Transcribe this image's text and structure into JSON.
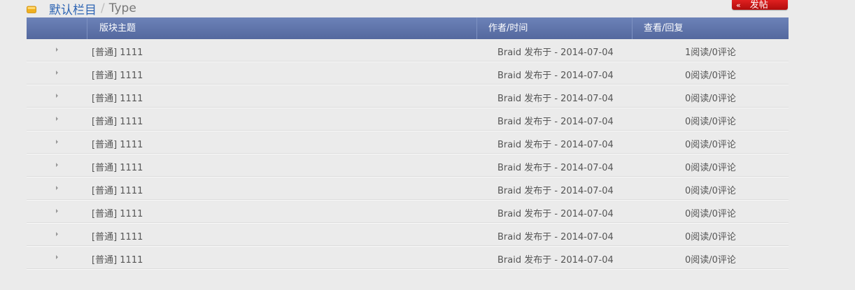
{
  "breadcrumb": {
    "current": "默认栏目",
    "separator": "/",
    "type": "Type"
  },
  "post_button": {
    "arrows": "«",
    "label": "发帖"
  },
  "table": {
    "headers": {
      "topic": "版块主题",
      "author": "作者/时间",
      "views": "查看/回复"
    },
    "rows": [
      {
        "topic": "[普通] 1111",
        "author": "Braid 发布于 - 2014-07-04",
        "stats": "1阅读/0评论"
      },
      {
        "topic": "[普通] 1111",
        "author": "Braid 发布于 - 2014-07-04",
        "stats": "0阅读/0评论"
      },
      {
        "topic": "[普通] 1111",
        "author": "Braid 发布于 - 2014-07-04",
        "stats": "0阅读/0评论"
      },
      {
        "topic": "[普通] 1111",
        "author": "Braid 发布于 - 2014-07-04",
        "stats": "0阅读/0评论"
      },
      {
        "topic": "[普通] 1111",
        "author": "Braid 发布于 - 2014-07-04",
        "stats": "0阅读/0评论"
      },
      {
        "topic": "[普通] 1111",
        "author": "Braid 发布于 - 2014-07-04",
        "stats": "0阅读/0评论"
      },
      {
        "topic": "[普通] 1111",
        "author": "Braid 发布于 - 2014-07-04",
        "stats": "0阅读/0评论"
      },
      {
        "topic": "[普通] 1111",
        "author": "Braid 发布于 - 2014-07-04",
        "stats": "0阅读/0评论"
      },
      {
        "topic": "[普通] 1111",
        "author": "Braid 发布于 - 2014-07-04",
        "stats": "0阅读/0评论"
      },
      {
        "topic": "[普通] 1111",
        "author": "Braid 发布于 - 2014-07-04",
        "stats": "0阅读/0评论"
      }
    ]
  },
  "colors": {
    "link": "#2d64b3",
    "header_bg": "#5c71a8",
    "button_red": "#c81414",
    "page_bg": "#ebebeb"
  },
  "icons": {
    "breadcrumb": "folder-icon",
    "row": "arrow-right-icon"
  }
}
